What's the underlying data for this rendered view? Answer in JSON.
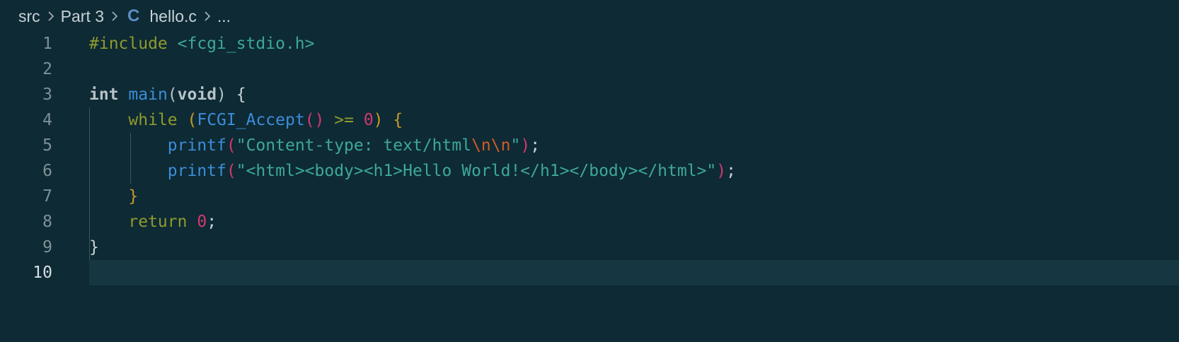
{
  "breadcrumb": {
    "items": [
      "src",
      "Part 3",
      "hello.c",
      "..."
    ],
    "file_icon": "c-language-icon",
    "file_icon_glyph": "C"
  },
  "editor": {
    "active_line": 10,
    "lines": [
      {
        "number": "1",
        "tokens": [
          {
            "cls": "t-pre",
            "text": "#include "
          },
          {
            "cls": "t-inc",
            "text": "<fcgi_stdio.h>"
          }
        ]
      },
      {
        "number": "2",
        "tokens": []
      },
      {
        "number": "3",
        "tokens": [
          {
            "cls": "t-type",
            "text": "int"
          },
          {
            "cls": "t-plain",
            "text": " "
          },
          {
            "cls": "t-fn",
            "text": "main"
          },
          {
            "cls": "t-ph",
            "text": "("
          },
          {
            "cls": "t-type",
            "text": "void"
          },
          {
            "cls": "t-ph",
            "text": ")"
          },
          {
            "cls": "t-plain",
            "text": " {"
          }
        ]
      },
      {
        "number": "4",
        "tokens": [
          {
            "cls": "t-plain",
            "text": "    "
          },
          {
            "cls": "t-kw",
            "text": "while"
          },
          {
            "cls": "t-plain",
            "text": " "
          },
          {
            "cls": "t-br2",
            "text": "("
          },
          {
            "cls": "t-fn",
            "text": "FCGI_Accept"
          },
          {
            "cls": "t-br3",
            "text": "()"
          },
          {
            "cls": "t-plain",
            "text": " "
          },
          {
            "cls": "t-kw",
            "text": ">="
          },
          {
            "cls": "t-plain",
            "text": " "
          },
          {
            "cls": "t-num",
            "text": "0"
          },
          {
            "cls": "t-br2",
            "text": ")"
          },
          {
            "cls": "t-plain",
            "text": " "
          },
          {
            "cls": "t-br2",
            "text": "{"
          }
        ]
      },
      {
        "number": "5",
        "tokens": [
          {
            "cls": "t-plain",
            "text": "        "
          },
          {
            "cls": "t-fn",
            "text": "printf"
          },
          {
            "cls": "t-br3",
            "text": "("
          },
          {
            "cls": "t-str",
            "text": "\"Content-type: text/html"
          },
          {
            "cls": "t-esc",
            "text": "\\n\\n"
          },
          {
            "cls": "t-str",
            "text": "\""
          },
          {
            "cls": "t-br3",
            "text": ")"
          },
          {
            "cls": "t-plain",
            "text": ";"
          }
        ]
      },
      {
        "number": "6",
        "tokens": [
          {
            "cls": "t-plain",
            "text": "        "
          },
          {
            "cls": "t-fn",
            "text": "printf"
          },
          {
            "cls": "t-br3",
            "text": "("
          },
          {
            "cls": "t-str",
            "text": "\"<html><body><h1>Hello World!</h1></body></html>\""
          },
          {
            "cls": "t-br3",
            "text": ")"
          },
          {
            "cls": "t-plain",
            "text": ";"
          }
        ]
      },
      {
        "number": "7",
        "tokens": [
          {
            "cls": "t-plain",
            "text": "    "
          },
          {
            "cls": "t-br2",
            "text": "}"
          }
        ]
      },
      {
        "number": "8",
        "tokens": [
          {
            "cls": "t-plain",
            "text": "    "
          },
          {
            "cls": "t-kw",
            "text": "return"
          },
          {
            "cls": "t-plain",
            "text": " "
          },
          {
            "cls": "t-num",
            "text": "0"
          },
          {
            "cls": "t-plain",
            "text": ";"
          }
        ]
      },
      {
        "number": "9",
        "tokens": [
          {
            "cls": "t-plain",
            "text": "}"
          }
        ]
      },
      {
        "number": "10",
        "tokens": []
      }
    ]
  },
  "colors": {
    "background": "#0d2a35",
    "current_line": "#163742",
    "line_number": "#7f9096",
    "function": "#3d8dd8",
    "keyword": "#929a2c",
    "string": "#3fa79a",
    "number": "#d3386f",
    "escape": "#d45a24"
  }
}
